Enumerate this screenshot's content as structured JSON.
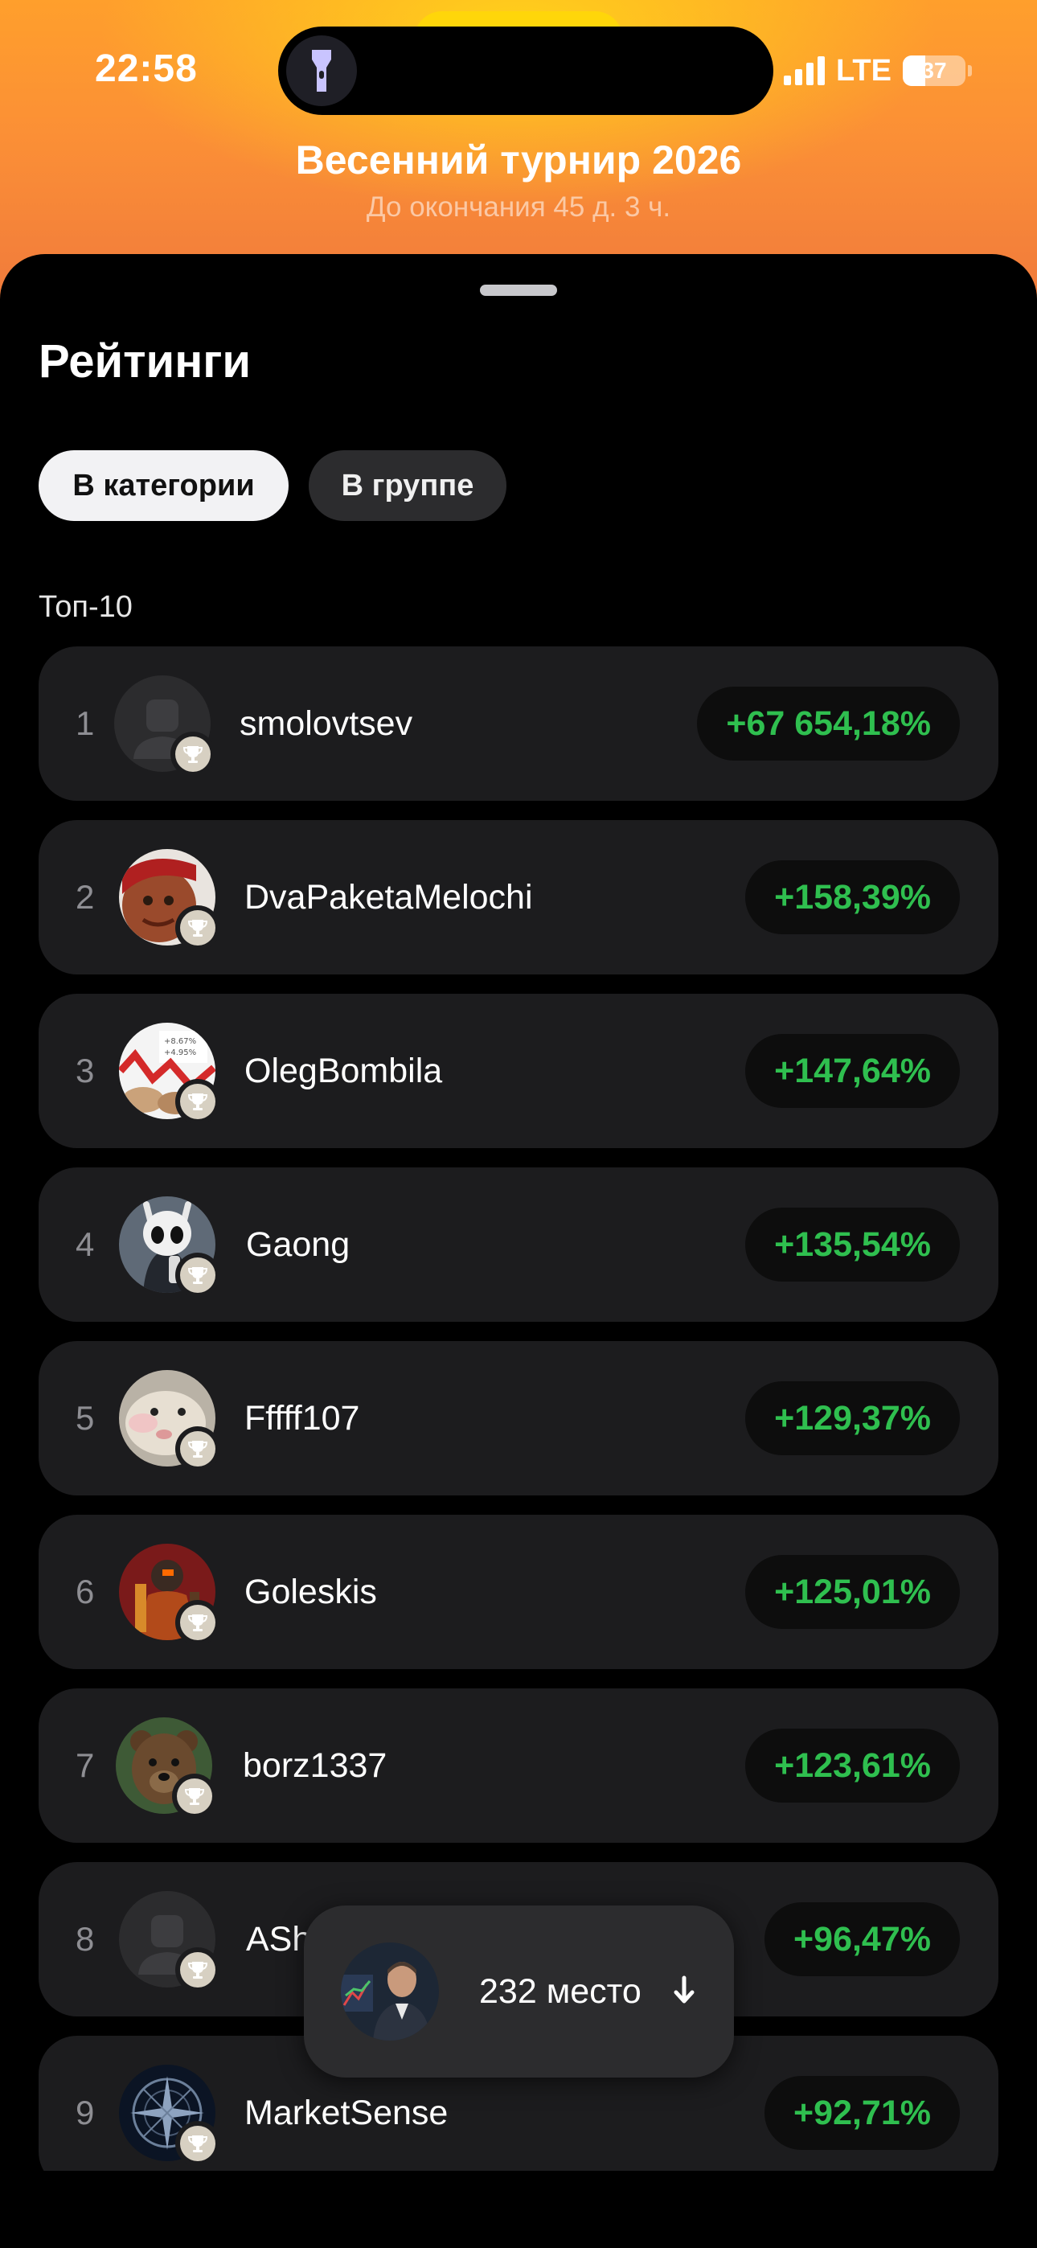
{
  "status_bar": {
    "time": "22:58",
    "network": "LTE",
    "battery": "37",
    "battery_level": 0.37,
    "flashlight_icon": "flashlight-icon"
  },
  "tournament": {
    "title": "Весенний турнир 2026",
    "subtitle": "До окончания 45 д. 3 ч."
  },
  "sheet": {
    "title": "Рейтинги",
    "tabs": [
      {
        "label": "В категории",
        "active": true
      },
      {
        "label": "В группе",
        "active": false
      }
    ],
    "section_label": "Топ-10"
  },
  "leaderboard": [
    {
      "rank": "1",
      "name": "smolovtsev",
      "score": "+67 654,18%",
      "avatar": "default-avatar"
    },
    {
      "rank": "2",
      "name": "DvaPaketaMelochi",
      "score": "+158,39%",
      "avatar": "photo-avatar"
    },
    {
      "rank": "3",
      "name": "OlegBombila",
      "score": "+147,64%",
      "avatar": "chart-avatar"
    },
    {
      "rank": "4",
      "name": "Gaong",
      "score": "+135,54%",
      "avatar": "knight-avatar"
    },
    {
      "rank": "5",
      "name": "Fffff107",
      "score": "+129,37%",
      "avatar": "animal-avatar"
    },
    {
      "rank": "6",
      "name": "Goleskis",
      "score": "+125,01%",
      "avatar": "warrior-avatar"
    },
    {
      "rank": "7",
      "name": "borz1337",
      "score": "+123,61%",
      "avatar": "bear-avatar"
    },
    {
      "rank": "8",
      "name": "ASh",
      "score": "+96,47%",
      "avatar": "default-avatar"
    },
    {
      "rank": "9",
      "name": "MarketSense",
      "score": "+92,71%",
      "avatar": "compass-avatar"
    }
  ],
  "my_position": {
    "place": "232 место",
    "icon": "arrow-down-icon"
  },
  "colors": {
    "accent_green": "#2fbf4f",
    "header_orange": "#fb8f36",
    "row_bg": "#1c1c1e"
  }
}
